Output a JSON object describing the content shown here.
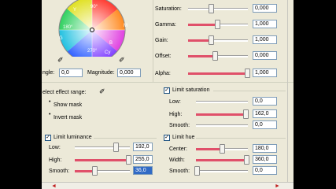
{
  "color_wheel": {
    "labels": [
      "90°",
      "180°",
      "270°",
      "Y",
      "G",
      "B",
      "M",
      "Cy"
    ],
    "angle_label": "ngle:",
    "angle_value": "0,0",
    "magnitude_label": "Magnitude:",
    "magnitude_value": "0,000"
  },
  "adjust": {
    "saturation_label": "Saturation:",
    "saturation_value": "0,000",
    "gamma_label": "Gamma:",
    "gamma_value": "1,000",
    "gain_label": "Gain:",
    "gain_value": "1,000",
    "offset_label": "Offset:",
    "offset_value": "0,000",
    "alpha_label": "Alpha:",
    "alpha_value": "1,000"
  },
  "effect_range": {
    "select_label": "elect effect range:",
    "show_mask": "Show mask",
    "invert_mask": "Invert mask"
  },
  "limit_saturation": {
    "title": "Limit saturation",
    "low_label": "Low:",
    "low_value": "0,0",
    "high_label": "High:",
    "high_value": "162,0",
    "smooth_label": "Smooth:",
    "smooth_value": "0,0"
  },
  "limit_luminance": {
    "title": "Limit luminance",
    "low_label": "Low:",
    "low_value": "192,0",
    "high_label": "High:",
    "high_value": "255,0",
    "smooth_label": "Smooth:",
    "smooth_value": "36,0"
  },
  "limit_hue": {
    "title": "Limit hue",
    "center_label": "Center:",
    "center_value": "180,0",
    "width_label": "Width:",
    "width_value": "360,0",
    "smooth_label": "Smooth:",
    "smooth_value": "0,0"
  },
  "colors": {
    "accent": "#e0506a",
    "panel": "#ece9d8",
    "selection": "#316ac5"
  }
}
